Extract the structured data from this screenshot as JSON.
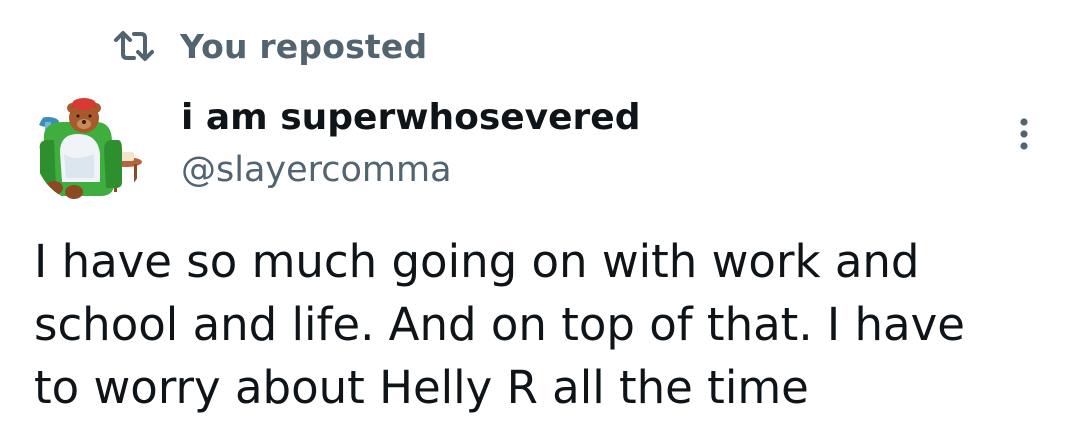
{
  "repost": {
    "icon": "repost-icon",
    "label": "You reposted"
  },
  "author": {
    "display_name": "i am superwhosevered",
    "handle": "@slayercomma",
    "avatar_icon": "teddy-bear-in-armchair-avatar"
  },
  "menu": {
    "icon": "more-vertical-icon"
  },
  "post": {
    "text": "I have so much going on with work and\nschool and life. And on top of that. I have\nto worry about Helly R all the time"
  },
  "colors": {
    "primary_text": "#0f1419",
    "secondary_text": "#536471",
    "background": "#ffffff"
  }
}
